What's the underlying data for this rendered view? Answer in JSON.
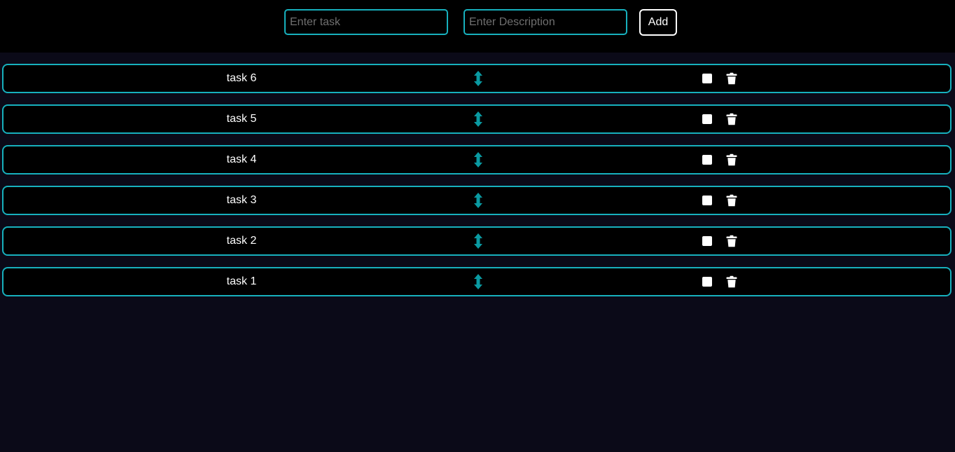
{
  "header": {
    "task_placeholder": "Enter task",
    "description_placeholder": "Enter Description",
    "add_label": "Add"
  },
  "tasks": [
    {
      "title": "task 6"
    },
    {
      "title": "task 5"
    },
    {
      "title": "task 4"
    },
    {
      "title": "task 3"
    },
    {
      "title": "task 2"
    },
    {
      "title": "task 1"
    }
  ],
  "icons": {
    "drag": "drag-vertical-arrows-icon",
    "complete": "checkbox-icon",
    "delete": "trash-icon"
  },
  "colors": {
    "accent": "#17b0bd",
    "drag_icon": "#0a9aa2",
    "header_bg": "#000000",
    "page_bg": "#0b0a18",
    "row_bg": "#000000"
  }
}
